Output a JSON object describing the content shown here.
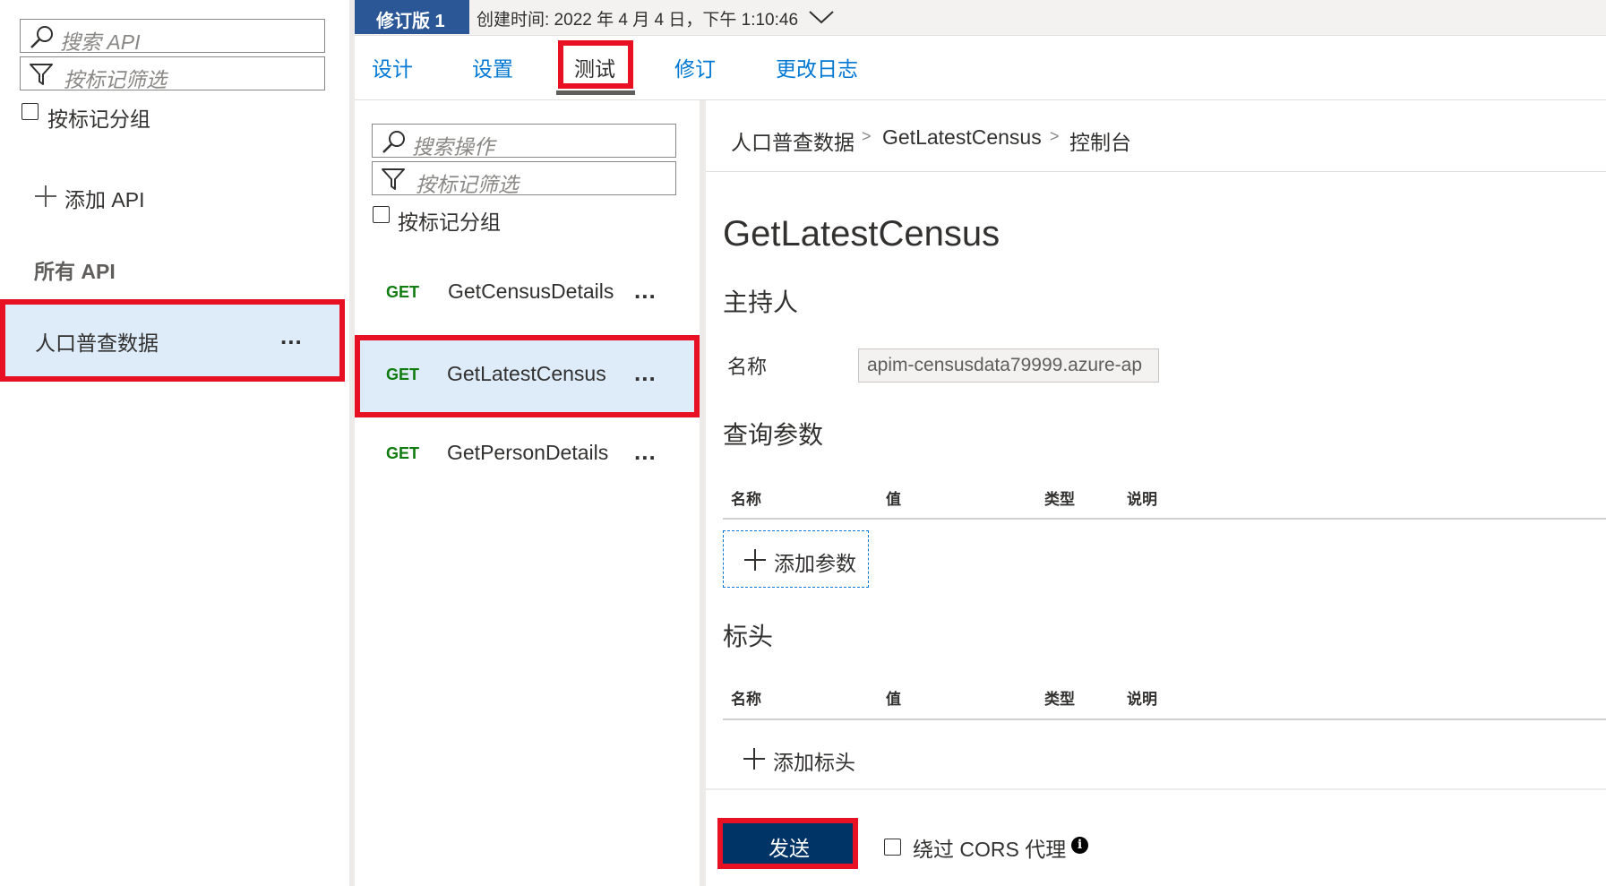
{
  "left": {
    "search_placeholder": "搜索 API",
    "filter_placeholder": "按标记筛选",
    "group_by_tag": "按标记分组",
    "add_api": "添加 API",
    "all_apis": "所有 API",
    "api_item": "人口普查数据"
  },
  "topbar": {
    "revision_badge": "修订版 1",
    "created": "创建时间: 2022 年 4 月 4 日，下午 1:10:46"
  },
  "tabs": [
    {
      "label": "设计"
    },
    {
      "label": "设置"
    },
    {
      "label": "测试"
    },
    {
      "label": "修订"
    },
    {
      "label": "更改日志"
    }
  ],
  "ops": {
    "search_placeholder": "搜索操作",
    "filter_placeholder": "按标记筛选",
    "group_by_tag": "按标记分组",
    "items": [
      {
        "method": "GET",
        "name": "GetCensusDetails"
      },
      {
        "method": "GET",
        "name": "GetLatestCensus"
      },
      {
        "method": "GET",
        "name": "GetPersonDetails"
      }
    ]
  },
  "console": {
    "breadcrumb": [
      "人口普查数据",
      "GetLatestCensus",
      "控制台"
    ],
    "title": "GetLatestCensus",
    "host_heading": "主持人",
    "host_label": "名称",
    "host_value": "apim-censusdata79999.azure-ap",
    "query_heading": "查询参数",
    "columns": [
      "名称",
      "值",
      "类型",
      "说明"
    ],
    "add_param": "添加参数",
    "headers_heading": "标头",
    "add_header": "添加标头",
    "send": "发送",
    "bypass_cors": "绕过 CORS 代理"
  },
  "colors": {
    "accent": "#0078d4",
    "get_method": "#107c10",
    "highlight": "#e81123",
    "selected_bg": "#deecf9",
    "send_bg": "#003366",
    "badge_bg": "#2b5797"
  }
}
